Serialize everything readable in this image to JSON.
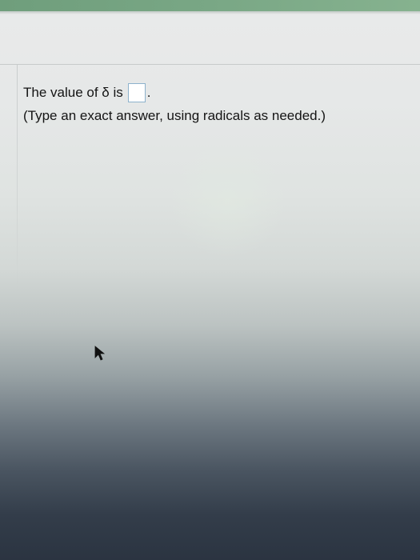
{
  "question": {
    "prefix": "The value of δ is",
    "suffix": ".",
    "hint": "(Type an exact answer, using radicals as needed.)"
  },
  "answer": {
    "value": ""
  },
  "icons": {
    "cursor": "mouse-pointer-icon"
  }
}
